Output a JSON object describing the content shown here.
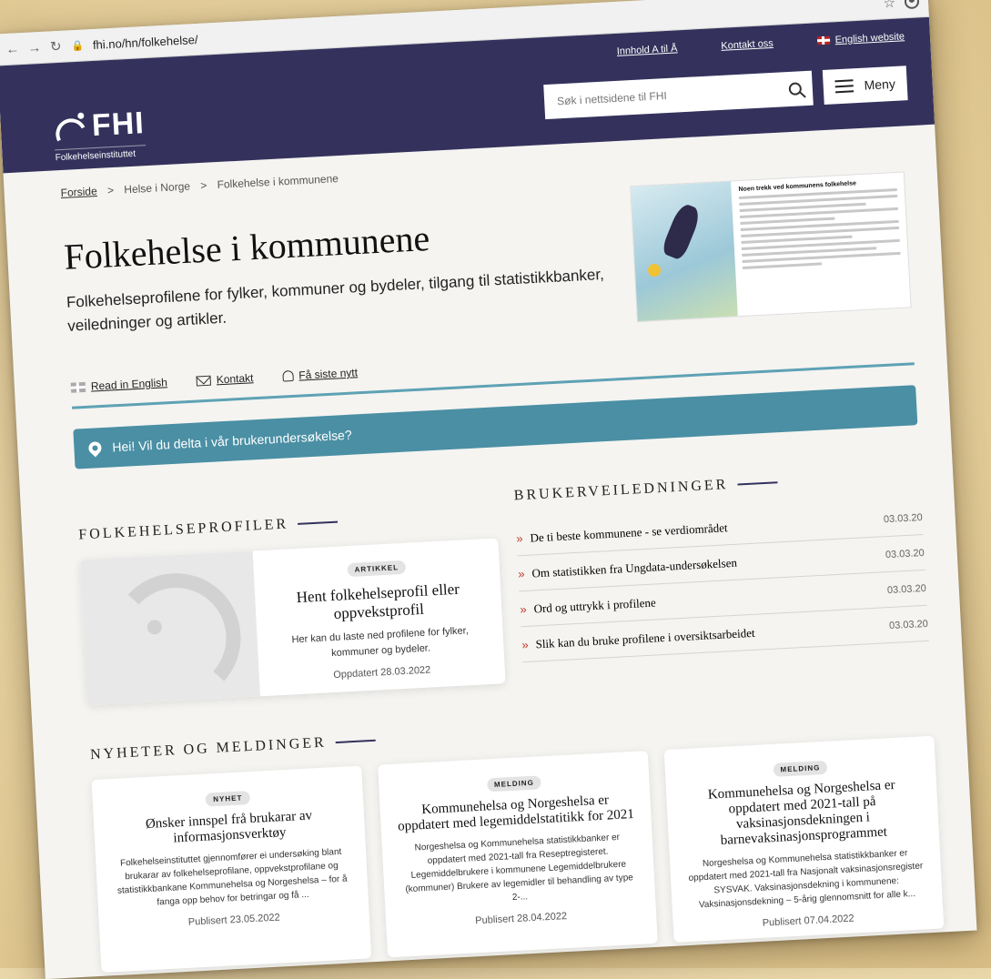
{
  "browser": {
    "url": "fhi.no/hn/folkehelse/"
  },
  "header": {
    "links": [
      {
        "label": "Innhold A til Å"
      },
      {
        "label": "Kontakt oss"
      },
      {
        "label": "English website"
      }
    ],
    "logo": {
      "name": "FHI",
      "subtitle": "Folkehelseinstituttet"
    },
    "search": {
      "placeholder": "Søk i nettsidene til FHI"
    },
    "menu_label": "Meny"
  },
  "breadcrumb": {
    "items": [
      "Forside",
      "Helse i Norge",
      "Folkehelse i kommunene"
    ],
    "separator": ">"
  },
  "page": {
    "title": "Folkehelse i kommunene",
    "lead": "Folkehelseprofilene for fylker, kommuner og bydeler, tilgang til statistikkbanker, veiledninger og artikler.",
    "hero_image_heading": "Noen trekk ved kommunens folkehelse"
  },
  "actions": [
    {
      "label": "Read in English",
      "icon": "flag-icon"
    },
    {
      "label": "Kontakt",
      "icon": "mail-icon"
    },
    {
      "label": "Få siste nytt",
      "icon": "bell-icon"
    }
  ],
  "survey_banner": {
    "text": "Hei! Vil du delta i vår brukerundersøkelse?"
  },
  "folkehelseprofiler": {
    "heading": "FOLKEHELSEPROFILER",
    "card": {
      "tag": "ARTIKKEL",
      "title": "Hent folkehelseprofil eller oppvekstprofil",
      "text": "Her kan du laste ned profilene for fylker, kommuner og bydeler.",
      "date": "Oppdatert 28.03.2022"
    }
  },
  "brukerveiledninger": {
    "heading": "BRUKERVEILEDNINGER",
    "items": [
      {
        "label": "De ti beste kommunene - se verdiområdet",
        "date": "03.03.20"
      },
      {
        "label": "Om statistikken fra Ungdata-undersøkelsen",
        "date": "03.03.20"
      },
      {
        "label": "Ord og uttrykk i profilene",
        "date": "03.03.20"
      },
      {
        "label": "Slik kan du bruke profilene i oversiktsarbeidet",
        "date": "03.03.20"
      }
    ]
  },
  "news": {
    "heading": "NYHETER OG MELDINGER",
    "cards": [
      {
        "tag": "NYHET",
        "title": "Ønsker innspel frå brukarar av informasjonsverktøy",
        "text": "Folkehelseinstituttet gjennomfører ei undersøking blant brukarar av folkehelseprofilane, oppvekstprofilane og statistikkbankane Kommunehelsa og Norgeshelsa – for å fanga opp behov for betringar og få ...",
        "date": "Publisert 23.05.2022"
      },
      {
        "tag": "MELDING",
        "title": "Kommunehelsa og Norgeshelsa er oppdatert med legemiddelstatitikk for 2021",
        "text": "Norgeshelsa og Kommunehelsa statistikkbanker er oppdatert med 2021-tall fra Reseptregisteret. Legemiddelbrukere i kommunene Legemiddelbrukere (kommuner) Brukere av legemidler til behandling av type 2-...",
        "date": "Publisert 28.04.2022"
      },
      {
        "tag": "MELDING",
        "title": "Kommunehelsa og Norgeshelsa er oppdatert med 2021-tall på vaksinasjonsdekningen i barnevaksinasjonsprogrammet",
        "text": "Norgeshelsa og Kommunehelsa statistikkbanker er oppdatert med 2021-tall fra Nasjonalt vaksinasjonsregister SYSVAK. Vaksinasjonsdekning i kommunene: Vaksinasjonsdekning – 5-årig glennomsnitt for alle k...",
        "date": "Publisert 07.04.2022"
      }
    ]
  },
  "colors": {
    "header_bg": "#34325c",
    "accent_teal": "#4a8fa4",
    "arrow_red": "#c0392b"
  }
}
